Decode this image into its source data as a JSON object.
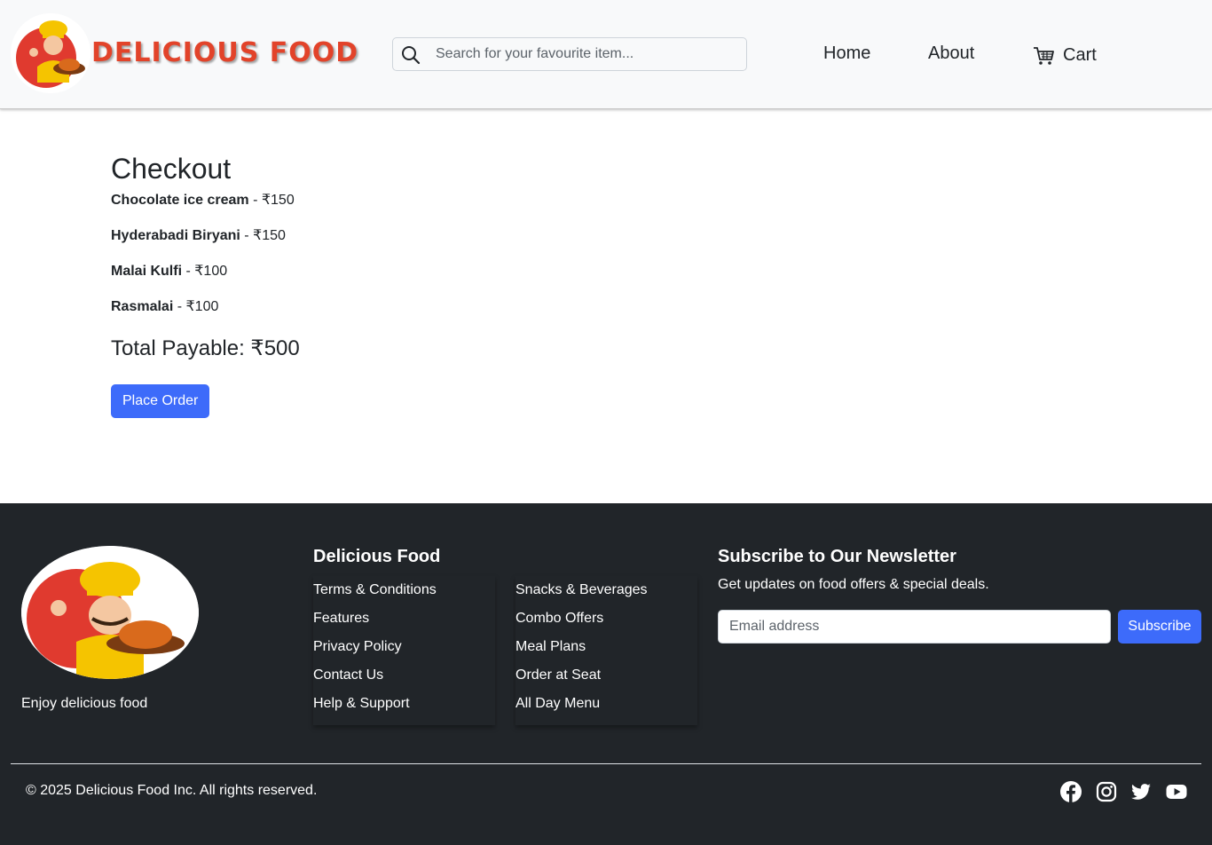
{
  "header": {
    "brand": "DELICIOUS FOOD",
    "search_placeholder": "Search for your favourite item...",
    "nav": {
      "home": "Home",
      "about": "About",
      "cart": "Cart"
    }
  },
  "checkout": {
    "title": "Checkout",
    "items": [
      {
        "name": "Chocolate ice cream",
        "price": " - ₹150"
      },
      {
        "name": "Hyderabadi Biryani",
        "price": " - ₹150"
      },
      {
        "name": "Malai Kulfi",
        "price": " - ₹100"
      },
      {
        "name": "Rasmalai",
        "price": " - ₹100"
      }
    ],
    "total": "Total Payable: ₹500",
    "place_order": "Place Order"
  },
  "footer": {
    "tagline": "Enjoy delicious food",
    "col_title": "Delicious Food",
    "links_1": [
      "Terms & Conditions",
      "Features",
      "Privacy Policy",
      "Contact Us",
      "Help & Support"
    ],
    "links_2": [
      "Snacks & Beverages",
      "Combo Offers",
      "Meal Plans",
      "Order at Seat",
      "All Day Menu"
    ],
    "newsletter": {
      "title": "Subscribe to Our Newsletter",
      "subtitle": "Get updates on food offers & special deals.",
      "placeholder": "Email address",
      "button": "Subscribe"
    },
    "copyright": "© 2025 Delicious Food Inc. All rights reserved.",
    "social": [
      "facebook-icon",
      "instagram-icon",
      "twitter-icon",
      "youtube-icon"
    ]
  },
  "colors": {
    "brand": "#e2432a",
    "primary": "#3d6bfa",
    "footer_bg": "#212529",
    "header_bg": "#f8f9fa"
  }
}
